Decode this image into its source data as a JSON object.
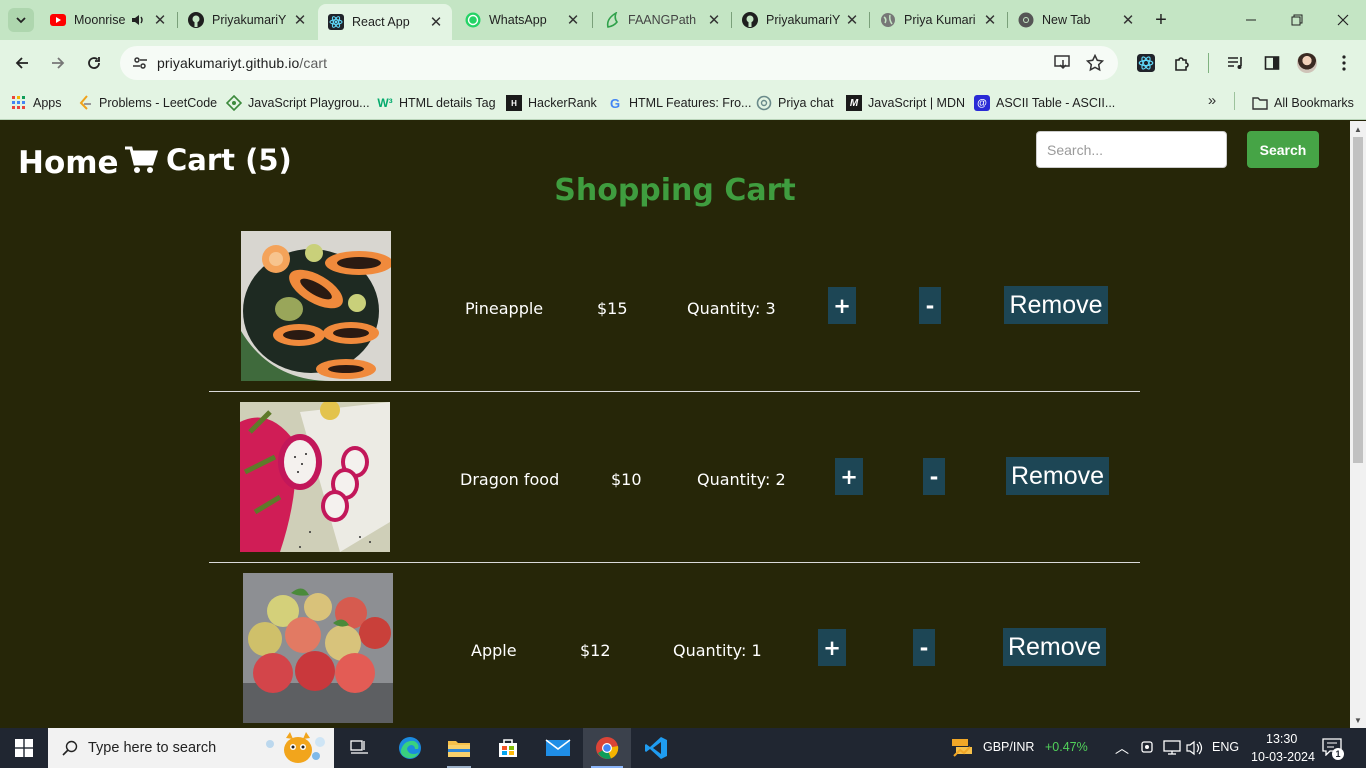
{
  "browser": {
    "tabs": [
      {
        "title": "Moonrise",
        "icon": "youtube-icon",
        "audio": true,
        "active": false
      },
      {
        "title": "PriyakumariY",
        "icon": "github-icon",
        "active": false
      },
      {
        "title": "React App",
        "icon": "react-icon",
        "active": true
      },
      {
        "title": "WhatsApp",
        "icon": "whatsapp-icon",
        "active": false
      },
      {
        "title": "FAANGPath",
        "icon": "faangpath-icon",
        "active": false
      },
      {
        "title": "PriyakumariY",
        "icon": "github-icon",
        "active": false
      },
      {
        "title": "Priya Kumari",
        "icon": "globe-icon",
        "active": false
      },
      {
        "title": "New Tab",
        "icon": "chrome-icon",
        "active": false
      }
    ],
    "url_host": "priyakumariyt.github.io",
    "url_path": "/cart",
    "bookmarks": [
      {
        "label": "Apps",
        "icon": "apps-grid-icon"
      },
      {
        "label": "Problems - LeetCode",
        "icon": "leetcode-icon"
      },
      {
        "label": "JavaScript Playgrou...",
        "icon": "playground-icon"
      },
      {
        "label": "HTML details Tag",
        "icon": "w3schools-icon"
      },
      {
        "label": "HackerRank",
        "icon": "hackerrank-icon"
      },
      {
        "label": "HTML Features: Fro...",
        "icon": "google-icon"
      },
      {
        "label": "Priya chat",
        "icon": "chatgpt-icon"
      },
      {
        "label": "JavaScript | MDN",
        "icon": "mdn-icon"
      },
      {
        "label": "ASCII Table - ASCII...",
        "icon": "ascii-icon"
      }
    ],
    "all_bookmarks": "All Bookmarks"
  },
  "page": {
    "nav_home": "Home",
    "nav_cart": "Cart (5)",
    "search_placeholder": "Search...",
    "search_button": "Search",
    "title": "Shopping Cart",
    "colors": {
      "background": "#262608",
      "title": "#3f9d3f",
      "button": "#1d4655",
      "search_button": "#46a446"
    },
    "items": [
      {
        "name": "Pineapple",
        "price": "$15",
        "quantity": "Quantity: 3",
        "plus": "+",
        "minus": "-",
        "remove": "Remove",
        "image": "papaya-image"
      },
      {
        "name": "Dragon food",
        "price": "$10",
        "quantity": "Quantity: 2",
        "plus": "+",
        "minus": "-",
        "remove": "Remove",
        "image": "dragon-fruit-image"
      },
      {
        "name": "Apple",
        "price": "$12",
        "quantity": "Quantity: 1",
        "plus": "+",
        "minus": "-",
        "remove": "Remove",
        "image": "apples-image"
      }
    ]
  },
  "taskbar": {
    "search_placeholder": "Type here to search",
    "stock_label": "GBP/INR",
    "stock_change": "+0.47%",
    "language": "ENG",
    "time": "13:30",
    "date": "10-03-2024",
    "notification_count": "1"
  }
}
